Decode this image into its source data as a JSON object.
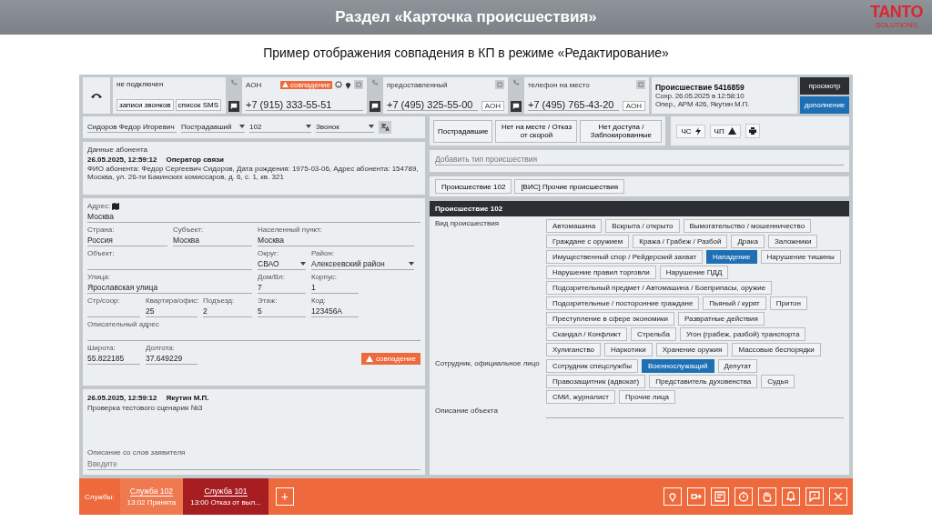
{
  "slide": {
    "title": "Раздел «Карточка происшествия»",
    "logo": "TANTO",
    "logo_sub": "SOLUTIONS",
    "subtitle": "Пример отображения совпадения в КП в режиме «Редактирование»"
  },
  "call_bar": {
    "status": "не подключен",
    "buttons": [
      "записи звонков",
      "список SMS"
    ],
    "phones": [
      {
        "label": "АОН",
        "number": "+7 (915) 333-55-51",
        "badge": "совпадение"
      },
      {
        "label": "предоставленный",
        "number": "+7 (495) 325-55-00",
        "tag": "АОН"
      },
      {
        "label": "телефон на место",
        "number": "+7 (495) 765-43-20",
        "tag": "АОН"
      }
    ],
    "incident": {
      "title": "Происшествие 5416859",
      "saved": "Сохр. 26.05.2025 в 12:58:10",
      "operator": "Опер., АРМ 426, Якутин М.П."
    },
    "actions": [
      {
        "label": "просмотр",
        "selected": false
      },
      {
        "label": "дополнение",
        "selected": true
      }
    ]
  },
  "caller": {
    "name": "Сидоров Федор Игоревич",
    "role": "Пострадавший",
    "service": "102",
    "source": "Звонок"
  },
  "subscriber": {
    "title": "Данные абонента",
    "date": "26.05.2025, 12:59:12",
    "operator": "Оператор связи",
    "details": "ФИО абонента: Федор Сергеевич Сидоров, Дата рождения: 1975-03-06, Адрес абонента: 154789, Москва, ул. 26-ти Бакинских комиссаров, д. 6, с. 1, кв. 321"
  },
  "address": {
    "label": "Адрес:",
    "value": "Москва",
    "groups": [
      {
        "fields": [
          {
            "label": "Страна:",
            "value": "Россия"
          },
          {
            "label": "Субъект:",
            "value": "Москва"
          },
          {
            "label": "Населенный пункт:",
            "value": "Москва"
          }
        ]
      },
      {
        "fields": [
          {
            "label": "Объект:"
          },
          {
            "label": "Округ:",
            "value": "СВАО",
            "kind": "dropdown"
          },
          {
            "label": "Район:",
            "value": "Алексеевский район",
            "kind": "dropdown"
          }
        ]
      },
      {
        "fields": [
          {
            "label": "Улица:",
            "value": "Ярославская улица"
          },
          {
            "label": "Дом/Вл:",
            "value": "7"
          },
          {
            "label": "Корпус:",
            "value": "1"
          }
        ]
      },
      {
        "fields": [
          {
            "label": "Стр/соор:"
          },
          {
            "label": "Квартира/офис:",
            "value": "25"
          },
          {
            "label": "Подъезд:",
            "value": "2"
          },
          {
            "label": "Этаж:",
            "value": "5"
          },
          {
            "label": "Код:",
            "value": "123456A"
          }
        ]
      },
      {
        "fields": [
          {
            "label": "Описательный адрес"
          }
        ]
      },
      {
        "fields": [
          {
            "label": "Широта:",
            "value": "55.822185"
          },
          {
            "label": "Долгота:",
            "value": "37.649229"
          }
        ]
      }
    ],
    "match_button": "совпадение"
  },
  "note": {
    "date": "26.05.2025, 12:59:12",
    "author": "Якутин М.П.",
    "text": "Проверка тестового сценария №3",
    "description_label": "Описание со слов заявителя",
    "placeholder": "Введите"
  },
  "flags": [
    "Пострадавшие",
    "Нет на месте / Отказ от скорой",
    "Нет доступа / Заблокированные"
  ],
  "markers": [
    "ЧС",
    "ЧП"
  ],
  "add_type": {
    "placeholder": "Добавить тип происшествия"
  },
  "tabs": [
    {
      "label": "Происшествие 102",
      "selected": false
    },
    {
      "label": "[ВИС] Прочие происшествия",
      "selected": false
    }
  ],
  "section": {
    "title": "Происшествие 102",
    "groups": [
      {
        "label": "Вид происшествия",
        "options": [
          {
            "label": "Автомашина",
            "selected": false
          },
          {
            "label": "Вскрыта / открыто",
            "selected": false
          },
          {
            "label": "Вымогательство / мошенничество",
            "selected": false
          },
          {
            "label": "Граждане с оружием",
            "selected": false
          },
          {
            "label": "Кража / Грабеж / Разбой",
            "selected": false
          },
          {
            "label": "Драка",
            "selected": false
          },
          {
            "label": "Заложники",
            "selected": false
          },
          {
            "label": "Имущественный спор / Рейдерский захват",
            "selected": false
          },
          {
            "label": "Нападение",
            "selected": true
          },
          {
            "label": "Нарушение тишины",
            "selected": false
          },
          {
            "label": "Нарушение правил торговли",
            "selected": false
          },
          {
            "label": "Нарушение ПДД",
            "selected": false
          },
          {
            "label": "Подозрительный предмет / Автомашина / Боеприпасы, оружие",
            "selected": false
          },
          {
            "label": "Подозрительные / посторонние граждане",
            "selected": false
          },
          {
            "label": "Пьяный / курят",
            "selected": false
          },
          {
            "label": "Притон",
            "selected": false
          },
          {
            "label": "Преступление в сфере экономики",
            "selected": false
          },
          {
            "label": "Развратные действия",
            "selected": false
          },
          {
            "label": "Скандал / Конфликт",
            "selected": false
          },
          {
            "label": "Стрельба",
            "selected": false
          },
          {
            "label": "Угон (грабеж, разбой) транспорта",
            "selected": false
          },
          {
            "label": "Хулиганство",
            "selected": false
          },
          {
            "label": "Наркотики",
            "selected": false
          },
          {
            "label": "Хранение оружия",
            "selected": false
          },
          {
            "label": "Массовые беспорядки",
            "selected": false
          }
        ]
      },
      {
        "label": "Сотрудник, официальное лицо",
        "options": [
          {
            "label": "Сотрудник спецслужбы",
            "selected": false
          },
          {
            "label": "Военнослужащий",
            "selected": true
          },
          {
            "label": "Депутат",
            "selected": false
          },
          {
            "label": "Правозащитник (адвокат)",
            "selected": false
          },
          {
            "label": "Представитель духовенства",
            "selected": false
          },
          {
            "label": "Судья",
            "selected": false
          },
          {
            "label": "СМИ, журналист",
            "selected": false
          },
          {
            "label": "Прочие лица",
            "selected": false
          }
        ]
      }
    ],
    "object_label": "Описание объекта"
  },
  "footer": {
    "label": "Службы:",
    "services": [
      {
        "name": "Служба 102",
        "status": "13:02 Принята",
        "selected": false
      },
      {
        "name": "Служба 101",
        "status": "13:00 Отказ от выл...",
        "selected": true
      }
    ],
    "add": "+"
  }
}
